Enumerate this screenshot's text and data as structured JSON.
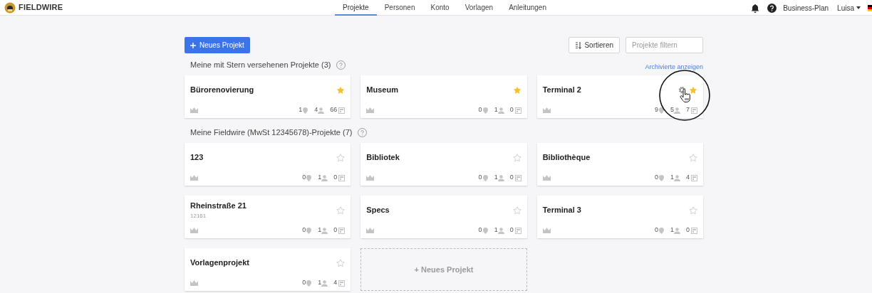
{
  "header": {
    "logo": "FIELDWIRE",
    "nav": [
      {
        "label": "Projekte",
        "selected": true
      },
      {
        "label": "Personen",
        "selected": false
      },
      {
        "label": "Konto",
        "selected": false
      },
      {
        "label": "Vorlagen",
        "selected": false
      },
      {
        "label": "Anleitungen",
        "selected": false
      }
    ],
    "plan": "Business-Plan",
    "user": "Luisa"
  },
  "toolbar": {
    "new_button": "Neues Projekt",
    "sort_button": "Sortieren",
    "filter": {
      "placeholder": "Projekte filtern"
    }
  },
  "sections": [
    {
      "title": "Meine mit Stern versehenen Projekte (3)",
      "link": "Archivierte anzeigen",
      "cards": [
        {
          "name": "Bürorenovierung",
          "starred": true,
          "hovered": false,
          "tasks": "1",
          "members": "4",
          "sheets": "66"
        },
        {
          "name": "Museum",
          "starred": true,
          "hovered": false,
          "tasks": "0",
          "members": "1",
          "sheets": "0"
        },
        {
          "name": "Terminal 2",
          "starred": true,
          "hovered": true,
          "tasks": "9",
          "members": "5",
          "sheets": "7"
        }
      ]
    },
    {
      "title": "Meine Fieldwire (MwSt 12345678)-Projekte (7)",
      "cards": [
        {
          "name": "123",
          "starred": false,
          "hovered": false,
          "tasks": "0",
          "members": "1",
          "sheets": "0"
        },
        {
          "name": "Bibliotek",
          "starred": false,
          "hovered": false,
          "tasks": "0",
          "members": "1",
          "sheets": "0"
        },
        {
          "name": "Bibliothèque",
          "starred": false,
          "hovered": false,
          "tasks": "0",
          "members": "1",
          "sheets": "4"
        },
        {
          "name": "Rheinstraße 21",
          "subtitle": "12161",
          "starred": false,
          "hovered": false,
          "tasks": "0",
          "members": "1",
          "sheets": "0"
        },
        {
          "name": "Specs",
          "starred": false,
          "hovered": false,
          "tasks": "0",
          "members": "1",
          "sheets": "0"
        },
        {
          "name": "Terminal 3",
          "starred": false,
          "hovered": false,
          "tasks": "0",
          "members": "1",
          "sheets": "0"
        },
        {
          "name": "Vorlagenprojekt",
          "starred": false,
          "hovered": false,
          "tasks": "0",
          "members": "1",
          "sheets": "4"
        }
      ],
      "add_card": "+ Neues Projekt"
    }
  ]
}
